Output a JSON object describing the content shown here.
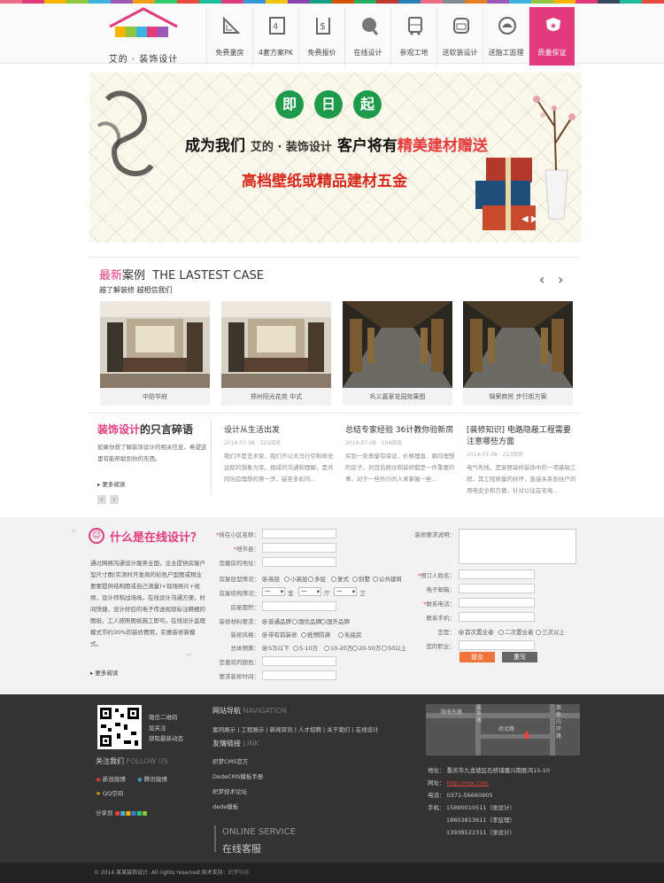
{
  "colors": [
    "#f06d8a",
    "#e23b7d",
    "#f7b500",
    "#8dc63f",
    "#3bb3e0",
    "#9b59b6",
    "#f39c12",
    "#2ecc71",
    "#e74c3c",
    "#1abc9c",
    "#e23b7d",
    "#3498db",
    "#f1c40f",
    "#8e44ad",
    "#16a085",
    "#d35400",
    "#27ae60",
    "#c0392b",
    "#2980b9",
    "#f06d8a",
    "#7f8c8d",
    "#e67e22",
    "#9b59b6",
    "#3bb3e0",
    "#8dc63f",
    "#f7b500",
    "#e23b7d",
    "#34495e",
    "#1abc9c",
    "#e74c3c"
  ],
  "logo": {
    "letters": "Ledeet",
    "brand": "艾的 · 装饰设计"
  },
  "nav": [
    {
      "label": "免费量房",
      "icon": "ruler-icon"
    },
    {
      "label": "4套方案PK",
      "icon": "pk-icon"
    },
    {
      "label": "免费报价",
      "icon": "price-icon"
    },
    {
      "label": "在线设计",
      "icon": "palette-icon"
    },
    {
      "label": "参观工地",
      "icon": "bus-icon"
    },
    {
      "label": "送软装设计",
      "icon": "sofa-icon"
    },
    {
      "label": "送施工监理",
      "icon": "helmet-icon"
    },
    {
      "label": "质量保证",
      "icon": "shield-icon",
      "active": true
    }
  ],
  "banner": {
    "badges": [
      "即",
      "日",
      "起"
    ],
    "line1_a": "成为我们",
    "line1_brand": "艾的 · 装饰设计",
    "line1_b": "客户将有",
    "line1_hl": "精美建材赠送",
    "line2": "高档壁纸或精品建材五金"
  },
  "cases": {
    "title_pink": "最新",
    "title_rest": "案例",
    "title_en": "THE LASTEST CASE",
    "sub": "越了解装修 越相信我们",
    "items": [
      {
        "caption": "中防华府"
      },
      {
        "caption": "郑州阳光花苑 中式"
      },
      {
        "caption": "巩义嘉家花园效果图"
      },
      {
        "caption": "锦荣商贸 步行街方案"
      }
    ]
  },
  "blog": {
    "title_pink": "装饰设计",
    "title_rest": "的只言碎语",
    "intro": "如果你想了解装饰设计的相关信息，希望这里有能帮助到你的东西。",
    "more": "更多阅读",
    "posts": [
      {
        "title": "设计从生活出发",
        "meta": "2014-07-08 · 225阅览",
        "excerpt": "我们不是艺术家，我们不以天马行空和奇无边际的想象为荣。祖成的沟通和理解，是共同创造理想的第一步，疑至多彩的..."
      },
      {
        "title": "总结专家经验 36计教你验新房",
        "meta": "2014-07-08 · 104阅览",
        "excerpt": "买到一处质量有保证，价格理直、朝向理想的房子，对目后居住和装修都是一件重要的事，对于一些外行的人来掌握一些..."
      },
      {
        "title": "[装修知识] 电路隐蔽工程需要注意哪些方面",
        "meta": "2014-07-08 · 213阅览",
        "excerpt": "电气布线，是家居装修装饰中的一项基础工程，其工程质量的好坏，直接关系到住户的用电安全和方便，针对以往在宅电..."
      }
    ]
  },
  "online": {
    "title": "什么是在线设计？",
    "text": "通过网络沟通设计服务全国，业主提供房屋户型尺寸图(实测时开发商的彩色户型图或物业要要提供结构图或自己测量)+现场照片+视频，设计师和战场场，在线设计沟通方便，时间快捷，设计好后的电子传送视现标注精细的图纸，工人按照图纸施工即可。在线设计监理模式节约30%的装修费用，实惠装修新模式。",
    "more": "更多阅读"
  },
  "form": {
    "area": "所在小区名称：",
    "city": "地市县：",
    "address": "您搬房的地址：",
    "type_label": "房屋层型情况：",
    "types": [
      "高层",
      "小高层",
      "多层",
      "复式",
      "别墅",
      "公共建筑"
    ],
    "struct_label": "房屋结构情况：",
    "struct_sel": [
      "一",
      "一",
      "一"
    ],
    "struct_units": [
      "室",
      "厅",
      "卫"
    ],
    "size": "房屋面积：",
    "material_label": "装修材料要求：",
    "materials": [
      "普通品牌",
      "国优品牌",
      "国外品牌"
    ],
    "style_label": "装修风格：",
    "styles": [
      "带有前装修",
      "抵预防满",
      "毛底房"
    ],
    "budget_label": "总体预算：",
    "budgets": [
      "5万以下",
      "5-10万",
      "10-20万",
      "20-50万",
      "50以上"
    ],
    "color": "您喜欢的颜色：",
    "time": "要求装修时间：",
    "req": "装修要求说明：",
    "name": "预订人姓名：",
    "email": "电子邮箱：",
    "phone": "联系电话：",
    "mobile": "联系手机：",
    "you_label": "您是：",
    "you": [
      "首次置业者",
      "二次置业者",
      "三次以上"
    ],
    "job": "您的职业：",
    "submit": "提交",
    "reset": "重写"
  },
  "footer": {
    "qr": [
      "微信二维码",
      "加关注",
      "获取最新动态"
    ],
    "follow_zh": "关注我们",
    "follow_en": "FOLLOW US",
    "socials": [
      "新浪微博",
      "腾讯微博",
      "QQ空间"
    ],
    "share": "分享到",
    "nav_zh": "网站导航",
    "nav_en": "NAVIGATION",
    "nav_links": "案例展示 | 工程展示 | 新闻资讯 | 人才招聘 | 关于我们 | 在线设计",
    "links_zh": "友情链接",
    "links_en": "LINK",
    "links": [
      "织梦CMS官方",
      "DedeCMS模板手册",
      "织梦技术论坛",
      "dede模板"
    ],
    "service_en": "ONLINE SERVICE",
    "service_zh": "在线客服",
    "map_labels": [
      "陇海东路",
      "未来路",
      "经北路",
      "商务内环路"
    ],
    "addr_label": "地址：",
    "addr": "重庆市九龙坡区石桥铺嘉兴南胜鸿15-10",
    "web_label": "网址：",
    "web": "http://xxx.com",
    "tel_label": "电话：",
    "tel": "0371-56660905",
    "mob_label": "手机：",
    "mobiles": [
      "15890010511（张设计）",
      "18603813611（李监理）",
      "13938522311（张设计）"
    ],
    "copyright": "© 2014 某某装饰设计. All rights reserved 技术支持：",
    "support": "织梦科技"
  }
}
